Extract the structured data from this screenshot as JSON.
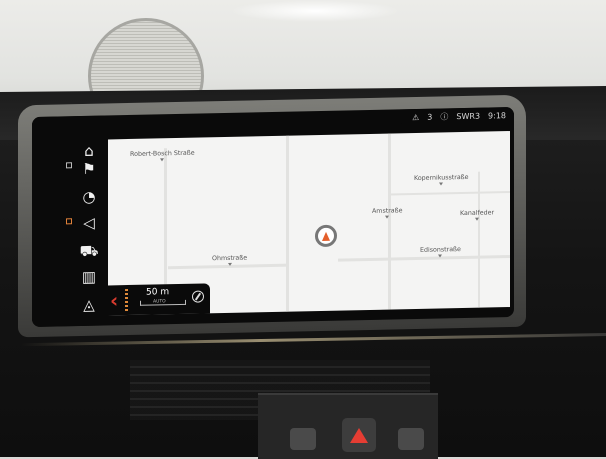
{
  "status": {
    "alert_count": "3",
    "radio": "SWR3",
    "time": "9:18"
  },
  "map": {
    "streets": [
      "Robert-Bosch Straße",
      "Kopernikusstraße",
      "Amstraße",
      "Kanalfeder",
      "Ohmstraße",
      "Edisonstraße"
    ]
  },
  "scale": {
    "value": "50 m",
    "mode": "AUTO"
  },
  "rail_icons": [
    "home-icon",
    "destination-flag-icon",
    "timer-icon",
    "speaker-icon",
    "car-icon",
    "map-book-icon",
    "compass-nav-icon"
  ],
  "colors": {
    "accent_red": "#d93b2f",
    "position_orange": "#e45f2b",
    "map_bg": "#f4f4f3"
  }
}
